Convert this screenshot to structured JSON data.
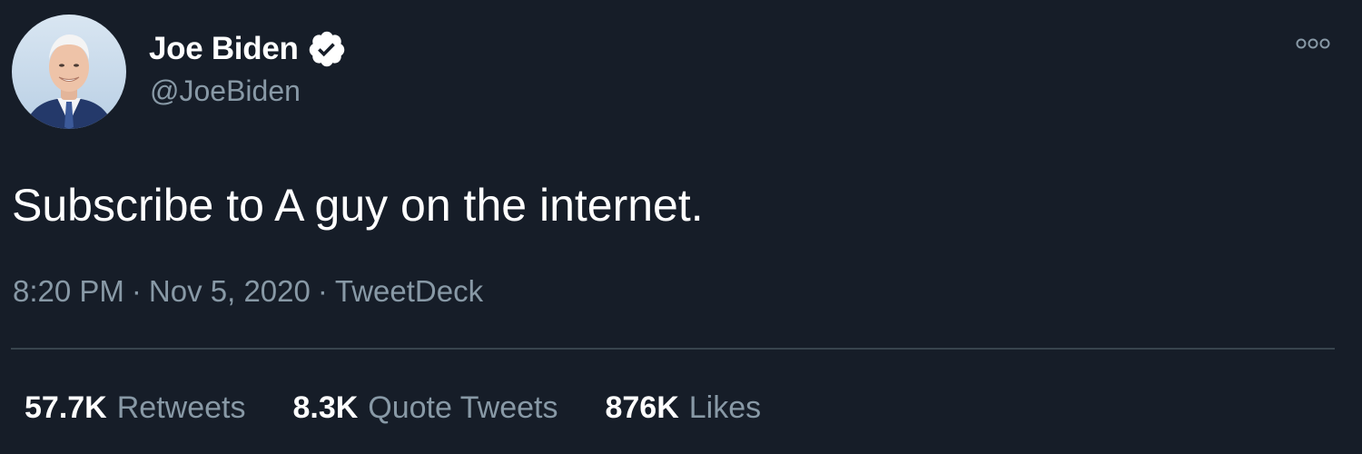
{
  "author": {
    "display_name": "Joe Biden",
    "handle": "@JoeBiden",
    "verified_icon": "verified-badge-icon"
  },
  "tweet": {
    "text": "Subscribe to A guy on the internet.",
    "time": "8:20 PM",
    "separator": "·",
    "date": "Nov 5, 2020",
    "source": "TweetDeck"
  },
  "stats": {
    "retweets": {
      "count": "57.7K",
      "label": "Retweets"
    },
    "quote_tweets": {
      "count": "8.3K",
      "label": "Quote Tweets"
    },
    "likes": {
      "count": "876K",
      "label": "Likes"
    }
  },
  "colors": {
    "background": "#161d28",
    "text_primary": "#ffffff",
    "text_secondary": "#8899a6",
    "divider": "#38444d"
  }
}
